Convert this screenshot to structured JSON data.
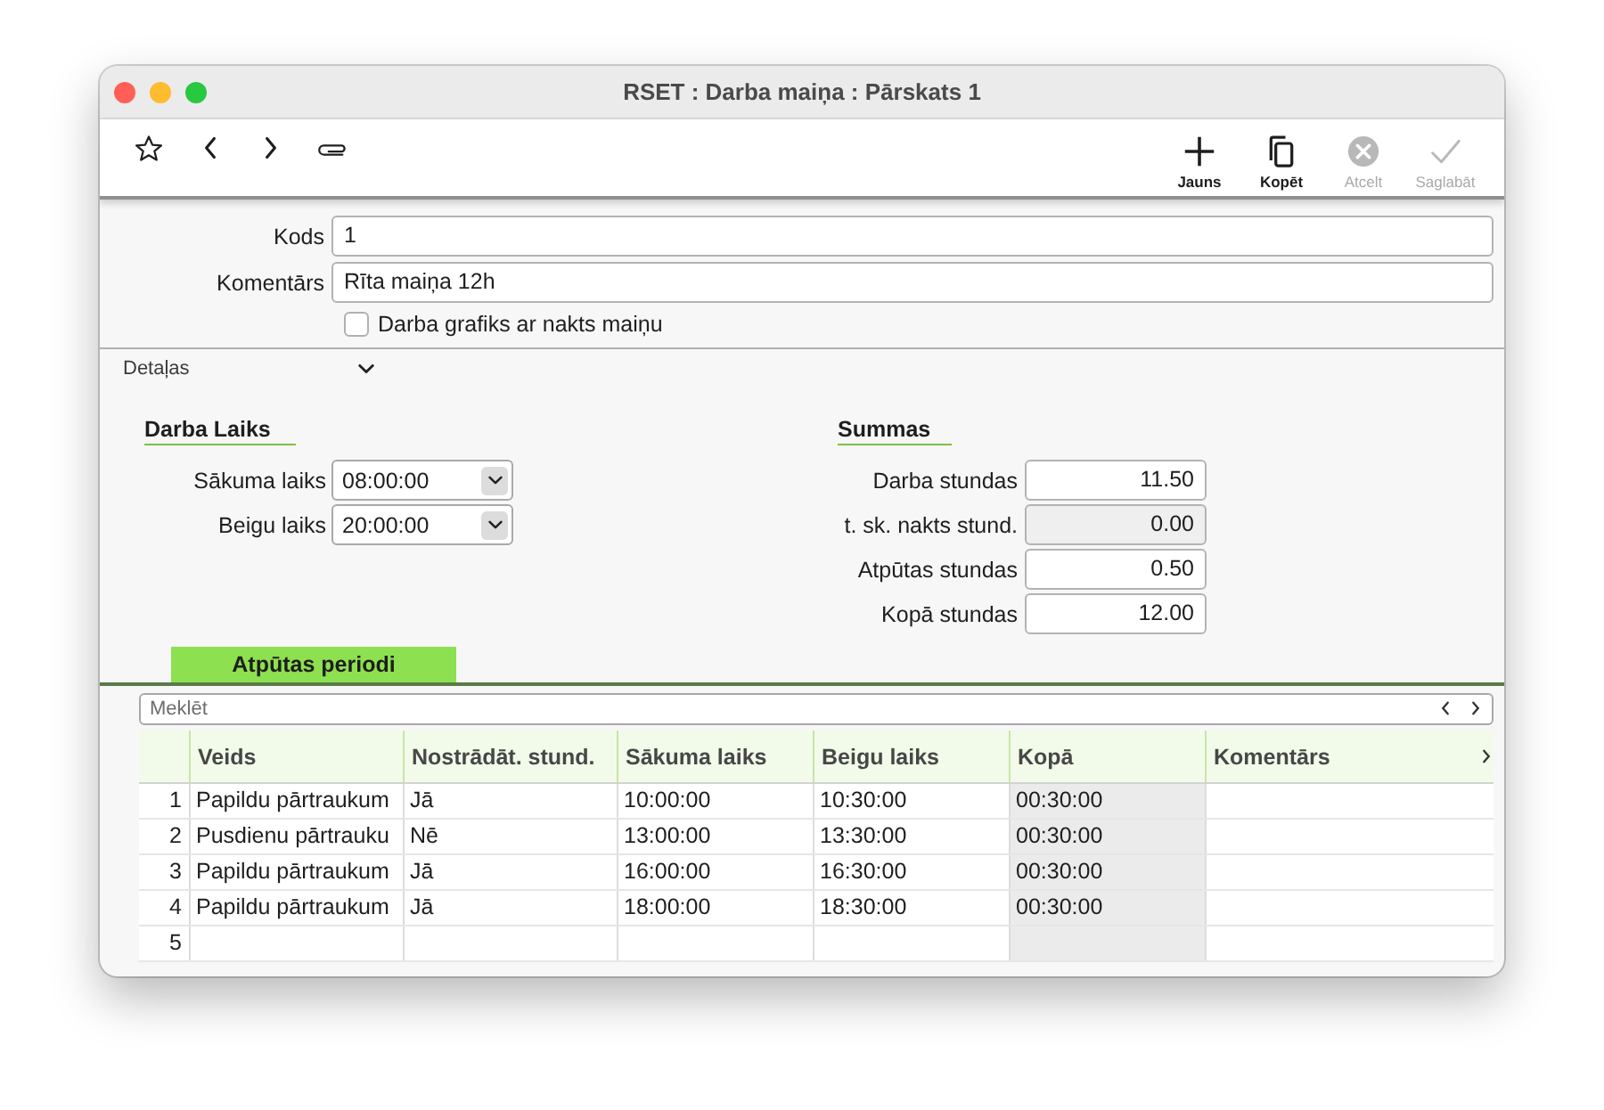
{
  "window": {
    "title": "RSET : Darba maiņa : Pārskats 1"
  },
  "toolbar": {
    "actions": [
      {
        "label": "Jauns",
        "disabled": false
      },
      {
        "label": "Kopēt",
        "disabled": false
      },
      {
        "label": "Atcelt",
        "disabled": true
      },
      {
        "label": "Saglabāt",
        "disabled": true
      }
    ]
  },
  "form": {
    "fields": [
      {
        "label": "Kods",
        "value": "1"
      },
      {
        "label": "Komentārs",
        "value": "Rīta maiņa 12h"
      }
    ],
    "checkbox": {
      "label": "Darba grafiks ar nakts maiņu",
      "checked": false
    }
  },
  "details": {
    "label": "Detaļas",
    "expanded": true,
    "groups": [
      {
        "title": "Darba Laiks",
        "fields": [
          {
            "kind": "select",
            "label": "Sākuma laiks",
            "value": "08:00:00",
            "readonly": false
          },
          {
            "kind": "select",
            "label": "Beigu laiks",
            "value": "20:00:00",
            "readonly": false
          }
        ]
      },
      {
        "title": "Summas",
        "fields": [
          {
            "kind": "number",
            "label": "Darba stundas",
            "value": "11.50",
            "readonly": false
          },
          {
            "kind": "number",
            "label": "t. sk. nakts stund.",
            "value": "0.00",
            "readonly": true
          },
          {
            "kind": "number",
            "label": "Atpūtas stundas",
            "value": "0.50",
            "readonly": false
          },
          {
            "kind": "number",
            "label": "Kopā stundas",
            "value": "12.00",
            "readonly": false
          }
        ]
      }
    ]
  },
  "tabs": [
    {
      "label": "Atpūtas periodi",
      "selected": true
    }
  ],
  "search": {
    "placeholder": "Meklēt"
  },
  "table": {
    "columns": [
      {
        "label": "Veids",
        "readonly": false
      },
      {
        "label": "Nostrādāt. stund.",
        "readonly": false
      },
      {
        "label": "Sākuma laiks",
        "readonly": false
      },
      {
        "label": "Beigu laiks",
        "readonly": false
      },
      {
        "label": "Kopā",
        "readonly": true
      },
      {
        "label": "Komentārs",
        "readonly": false
      }
    ],
    "rows": [
      {
        "number": "1",
        "cells": [
          "Papildu pārtraukum",
          "Jā",
          "10:00:00",
          "10:30:00",
          "00:30:00"
        ]
      },
      {
        "number": "2",
        "cells": [
          "Pusdienu pārtrauku",
          "Nē",
          "13:00:00",
          "13:30:00",
          "00:30:00"
        ]
      },
      {
        "number": "3",
        "cells": [
          "Papildu pārtraukum",
          "Jā",
          "16:00:00",
          "16:30:00",
          "00:30:00"
        ]
      },
      {
        "number": "4",
        "cells": [
          "Papildu pārtraukum",
          "Jā",
          "18:00:00",
          "18:30:00",
          "00:30:00"
        ]
      },
      {
        "number": "5"
      }
    ]
  }
}
